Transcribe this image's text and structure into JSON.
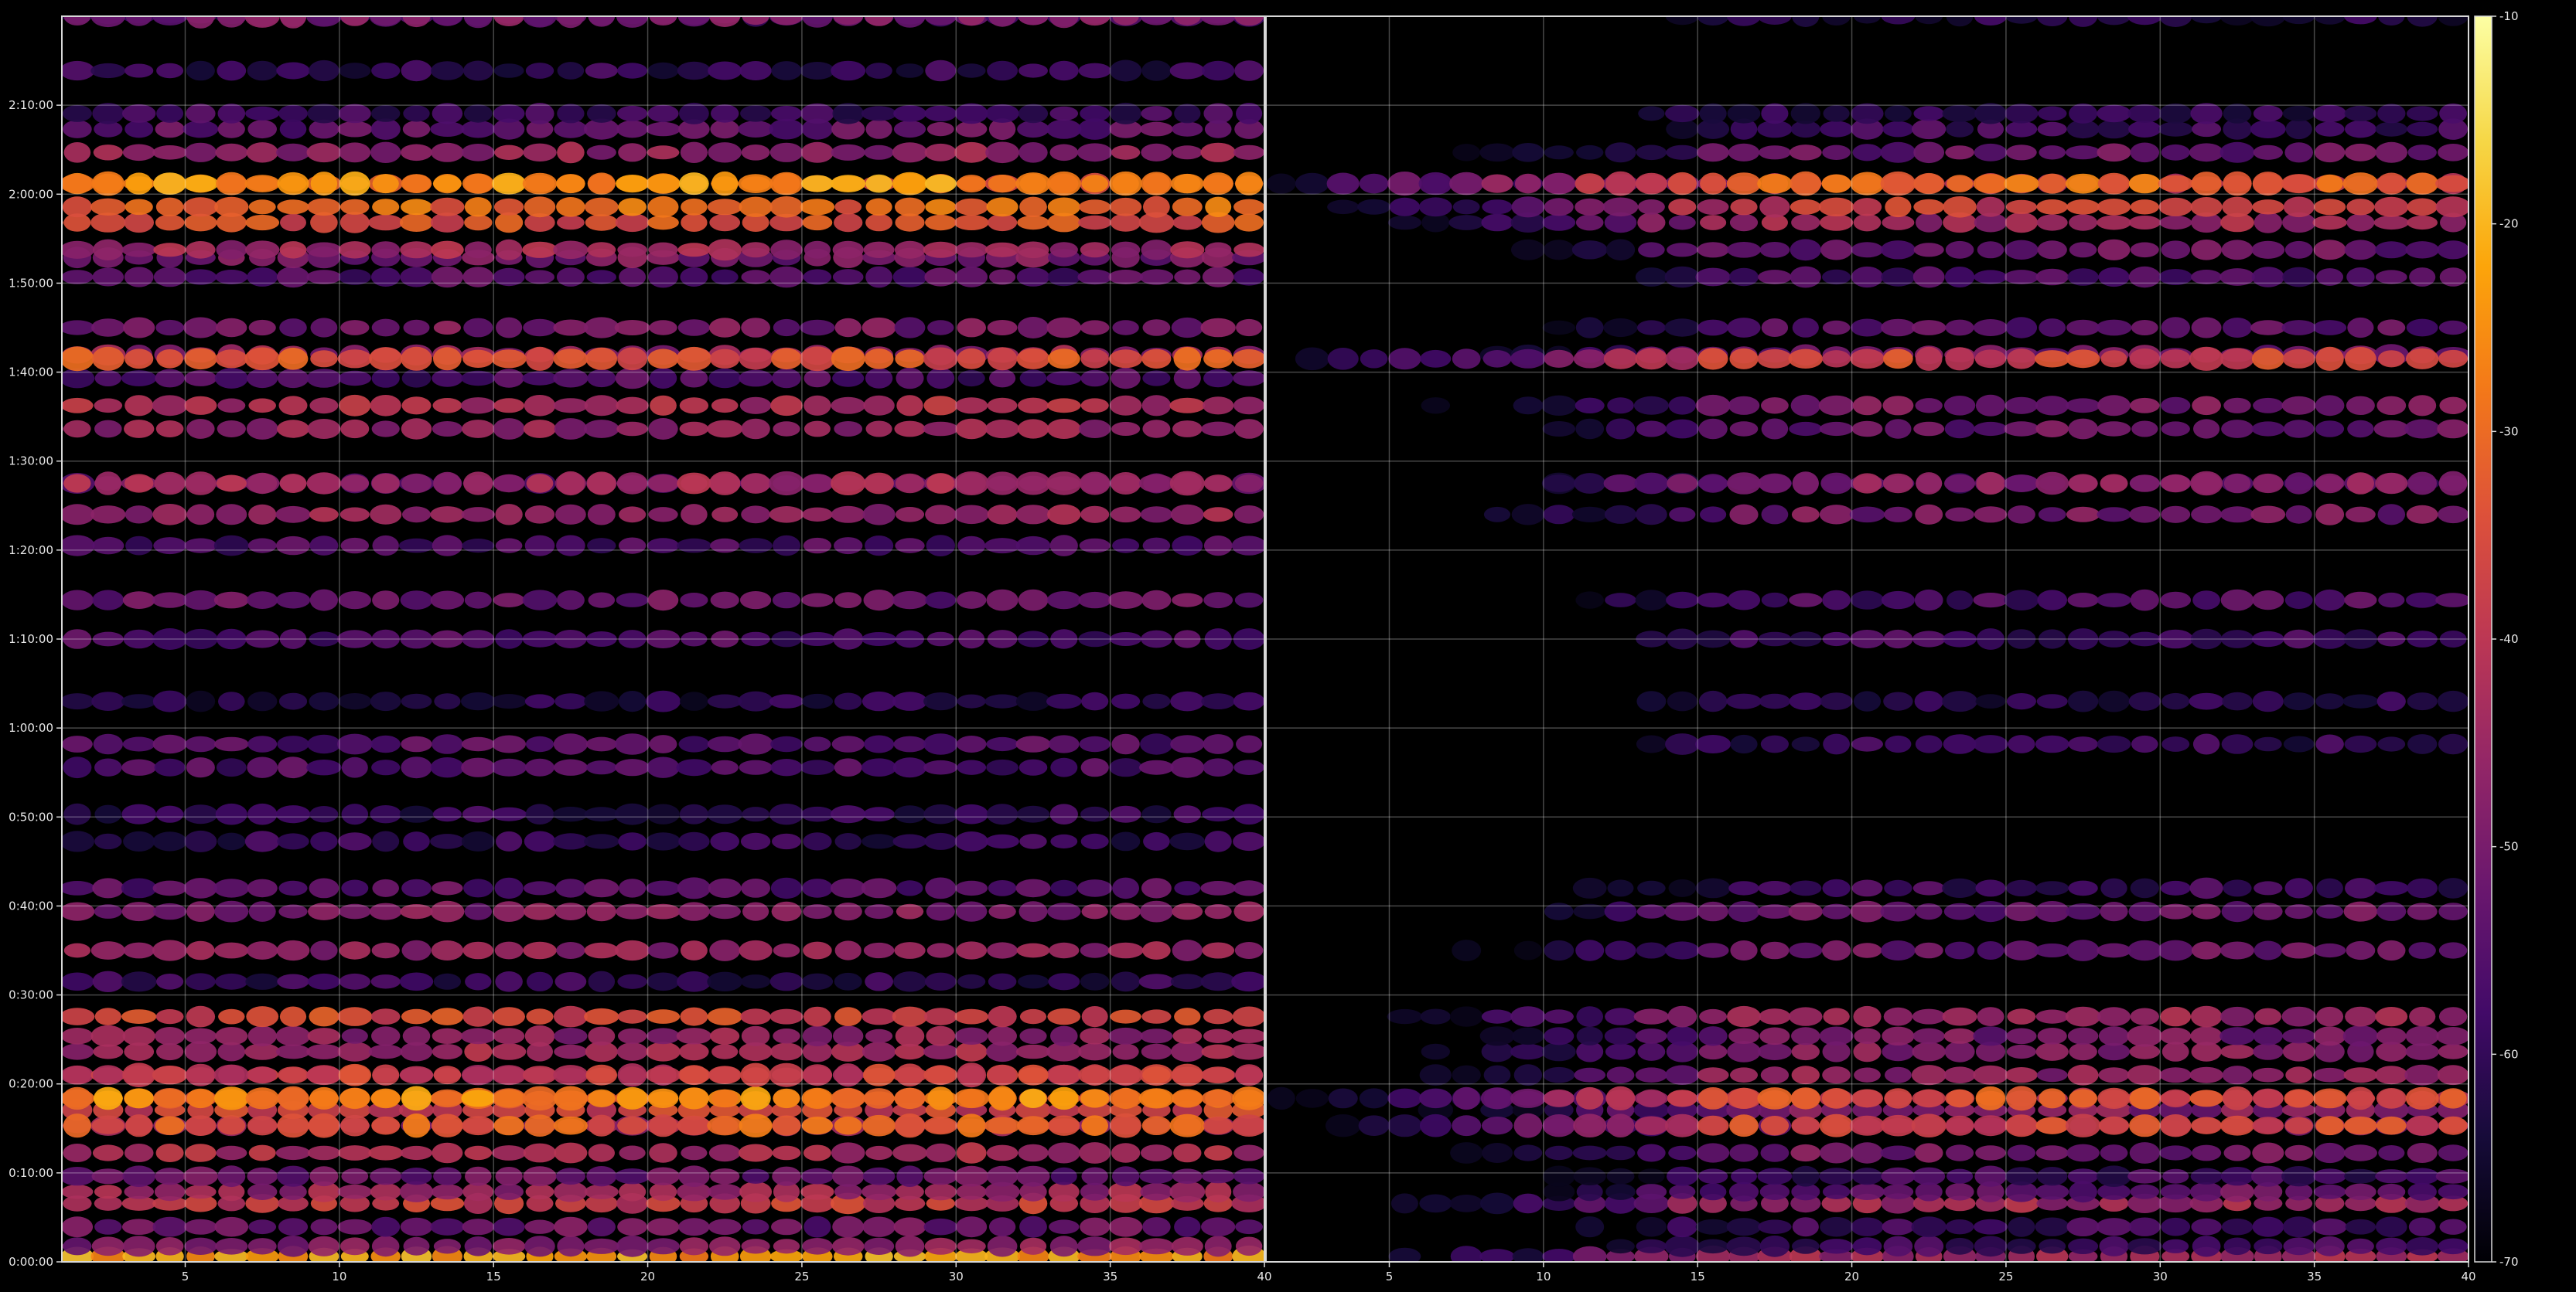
{
  "chart_data": {
    "type": "heatmap",
    "title": "",
    "xlabel": "",
    "ylabel": "",
    "grid": true,
    "colormap": "inferno",
    "background": "#000000",
    "panels": [
      {
        "name": "",
        "xlim": [
          1,
          40
        ],
        "x_ticks": [
          "5",
          "10",
          "15",
          "20",
          "25",
          "30",
          "35",
          "40"
        ],
        "x_tick_values": [
          5,
          10,
          15,
          20,
          25,
          30,
          35,
          40
        ],
        "rows": [
          {
            "t": 7,
            "level": -23
          },
          {
            "t": 20,
            "level": -48
          },
          {
            "t": 45,
            "level": -52
          },
          {
            "t": 75,
            "level": -38
          },
          {
            "t": 90,
            "level": -45
          },
          {
            "t": 110,
            "level": -52
          },
          {
            "t": 140,
            "level": -42
          },
          {
            "t": 175,
            "level": -46
          },
          {
            "t": 195,
            "level": -37
          },
          {
            "t": 210,
            "level": -30
          },
          {
            "t": 240,
            "level": -40
          },
          {
            "t": 270,
            "level": -44
          },
          {
            "t": 290,
            "level": -46
          },
          {
            "t": 315,
            "level": -36
          },
          {
            "t": 360,
            "level": -60
          },
          {
            "t": 400,
            "level": -46
          },
          {
            "t": 450,
            "level": -48
          },
          {
            "t": 480,
            "level": -54
          },
          {
            "t": 540,
            "level": -60
          },
          {
            "t": 575,
            "level": -60
          },
          {
            "t": 635,
            "level": -56
          },
          {
            "t": 665,
            "level": -55
          },
          {
            "t": 720,
            "level": -62
          },
          {
            "t": 800,
            "level": -56
          },
          {
            "t": 850,
            "level": -52
          },
          {
            "t": 920,
            "level": -56
          },
          {
            "t": 960,
            "level": -45
          },
          {
            "t": 1000,
            "level": -52
          },
          {
            "t": 1070,
            "level": -46
          },
          {
            "t": 1100,
            "level": -42
          },
          {
            "t": 1135,
            "level": -56
          },
          {
            "t": 1165,
            "level": -46
          },
          {
            "t": 1200,
            "level": -50
          },
          {
            "t": 1265,
            "level": -55
          },
          {
            "t": 1290,
            "level": -50
          },
          {
            "t": 1300,
            "level": -44
          },
          {
            "t": 1335,
            "level": -34
          },
          {
            "t": 1355,
            "level": -30
          },
          {
            "t": 1385,
            "level": -31
          },
          {
            "t": 1425,
            "level": -46
          },
          {
            "t": 1455,
            "level": -53
          },
          {
            "t": 1475,
            "level": -58
          },
          {
            "t": 1530,
            "level": -60
          },
          {
            "t": 1600,
            "level": -56
          }
        ],
        "hot_rows": [
          {
            "t": 175,
            "level": -32
          },
          {
            "t": 210,
            "level": -26
          },
          {
            "t": 240,
            "level": -38
          },
          {
            "t": 1000,
            "level": -44
          },
          {
            "t": 1160,
            "level": -34
          },
          {
            "t": 1385,
            "level": -24
          },
          {
            "t": 1600,
            "level": -50
          }
        ]
      },
      {
        "name": "",
        "xlim": [
          1,
          40
        ],
        "x_ticks": [
          "5",
          "10",
          "15",
          "20",
          "25",
          "30",
          "35",
          "40"
        ],
        "x_tick_values": [
          5,
          10,
          15,
          20,
          25,
          30,
          35,
          40
        ],
        "onset_x": 17,
        "rows": [
          {
            "t": 7,
            "level": -44
          },
          {
            "t": 20,
            "level": -58
          },
          {
            "t": 45,
            "level": -58
          },
          {
            "t": 75,
            "level": -44
          },
          {
            "t": 90,
            "level": -52
          },
          {
            "t": 110,
            "level": -58
          },
          {
            "t": 140,
            "level": -50
          },
          {
            "t": 175,
            "level": -50
          },
          {
            "t": 195,
            "level": -48
          },
          {
            "t": 210,
            "level": -40
          },
          {
            "t": 240,
            "level": -46
          },
          {
            "t": 270,
            "level": -48
          },
          {
            "t": 290,
            "level": -50
          },
          {
            "t": 315,
            "level": -44
          },
          {
            "t": 400,
            "level": -52
          },
          {
            "t": 450,
            "level": -52
          },
          {
            "t": 480,
            "level": -58
          },
          {
            "t": 665,
            "level": -60
          },
          {
            "t": 720,
            "level": -62
          },
          {
            "t": 800,
            "level": -58
          },
          {
            "t": 850,
            "level": -56
          },
          {
            "t": 960,
            "level": -50
          },
          {
            "t": 1000,
            "level": -56
          },
          {
            "t": 1070,
            "level": -52
          },
          {
            "t": 1100,
            "level": -50
          },
          {
            "t": 1165,
            "level": -50
          },
          {
            "t": 1200,
            "level": -54
          },
          {
            "t": 1265,
            "level": -56
          },
          {
            "t": 1300,
            "level": -52
          },
          {
            "t": 1335,
            "level": -44
          },
          {
            "t": 1355,
            "level": -38
          },
          {
            "t": 1385,
            "level": -42
          },
          {
            "t": 1425,
            "level": -52
          },
          {
            "t": 1455,
            "level": -58
          },
          {
            "t": 1475,
            "level": -60
          },
          {
            "t": 1600,
            "level": -62
          }
        ],
        "hot_rows": [
          {
            "t": 175,
            "level": -36
          },
          {
            "t": 210,
            "level": -34
          },
          {
            "t": 1000,
            "level": -48
          },
          {
            "t": 1160,
            "level": -36
          },
          {
            "t": 1385,
            "level": -30
          }
        ]
      }
    ],
    "ylim_seconds": [
      0,
      8400
    ],
    "y_ticks": [
      "0:00:00",
      "0:10:00",
      "0:20:00",
      "0:30:00",
      "0:40:00",
      "0:50:00",
      "1:00:00",
      "1:10:00",
      "1:20:00",
      "1:30:00",
      "1:40:00",
      "1:50:00",
      "2:00:00",
      "2:10:00"
    ],
    "y_tick_values": [
      0,
      600,
      1200,
      1800,
      2400,
      3000,
      3600,
      4200,
      4800,
      5400,
      6000,
      6600,
      7200,
      7800
    ],
    "colorbar": {
      "vmin": -70,
      "vmax": -10,
      "ticks": [
        "-10",
        "-20",
        "-30",
        "-40",
        "-50",
        "-60",
        "-70"
      ],
      "tick_values": [
        -10,
        -20,
        -30,
        -40,
        -50,
        -60,
        -70
      ]
    }
  }
}
